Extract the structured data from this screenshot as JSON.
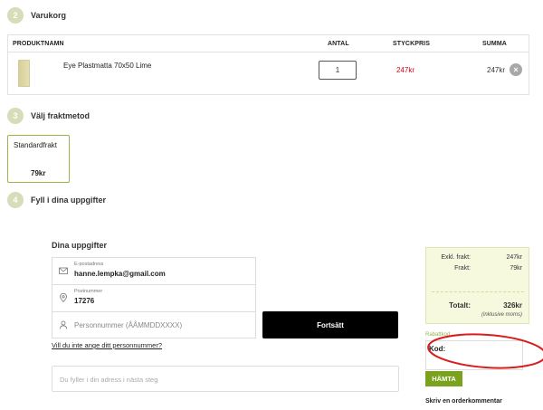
{
  "steps": {
    "cart": {
      "num": "2",
      "title": "Varukorg"
    },
    "shipping": {
      "num": "3",
      "title": "Välj fraktmetod"
    },
    "details": {
      "num": "4",
      "title": "Fyll i dina uppgifter"
    }
  },
  "cart": {
    "headers": {
      "product": "PRODUKTNAMN",
      "qty": "ANTAL",
      "unit": "STYCKPRIS",
      "sum": "SUMMA"
    },
    "item": {
      "name": "Eye Plastmatta 70x50 Lime",
      "qty": "1",
      "unit_price": "247kr",
      "sum": "247kr",
      "remove": "×"
    }
  },
  "shipping": {
    "name": "Standardfrakt",
    "price": "79kr"
  },
  "details": {
    "title": "Dina uppgifter",
    "email": {
      "label": "E-postadress",
      "value": "hanne.lempka@gmail.com"
    },
    "postal": {
      "label": "Postnummer",
      "value": "17276"
    },
    "pnr": {
      "placeholder": "Personnummer (ÅÅMMDDXXXX)"
    },
    "continue": "Fortsätt",
    "pnr_link": "Vill du inte ange ditt personnummer?",
    "address_placeholder": "Du fyller i din adress i nästa steg"
  },
  "summary": {
    "excl_label": "Exkl. frakt:",
    "excl_value": "247kr",
    "freight_label": "Frakt:",
    "freight_value": "79kr",
    "total_label": "Totalt:",
    "total_value": "326kr",
    "vat_note": "(inklusive moms)"
  },
  "coupon": {
    "title": "Rabattkod",
    "label": "Kod:",
    "button": "HÄMTA"
  },
  "comment": {
    "label": "Skriv en orderkommentar"
  },
  "colors": {
    "accent": "#9ab54a",
    "button_green": "#7aa21e",
    "price_red": "#d0021b",
    "highlight": "#d81e1e"
  }
}
